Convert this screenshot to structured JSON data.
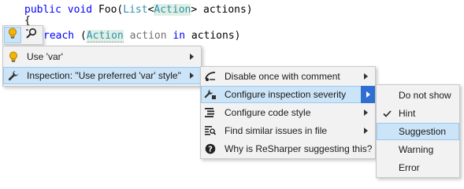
{
  "editor": {
    "line1": {
      "kw_public": "public",
      "kw_void": "void",
      "method": "Foo(",
      "type_list": "List",
      "lt": "<",
      "type_action": "Action",
      "gt": ">",
      "param": "actions)"
    },
    "line2": {
      "brace": "{"
    },
    "line3": {
      "kw_foreach": "reach",
      "open": "(",
      "type_action": "Action",
      "var": "action",
      "kw_in": "in",
      "rest": "actions)"
    }
  },
  "bulb_bar": {
    "bulb_icon": "lightbulb-icon",
    "find_icon": "find-usages-icon"
  },
  "menu1": {
    "items": [
      {
        "label": "Use 'var'",
        "icon": "lightbulb-icon"
      },
      {
        "label": "Inspection: \"Use preferred 'var' style\"",
        "icon": "wrench-icon"
      }
    ]
  },
  "menu2": {
    "items": [
      {
        "label": "Disable once with comment",
        "icon": "disable-comment-icon"
      },
      {
        "label": "Configure inspection severity",
        "icon": "severity-icon"
      },
      {
        "label": "Configure code style",
        "icon": "code-style-icon"
      },
      {
        "label": "Find similar issues in file",
        "icon": "find-similar-icon"
      },
      {
        "label": "Why is ReSharper suggesting this?",
        "icon": "help-icon"
      }
    ]
  },
  "menu3": {
    "items": [
      {
        "label": "Do not show"
      },
      {
        "label": "Hint",
        "checked": true
      },
      {
        "label": "Suggestion"
      },
      {
        "label": "Warning"
      },
      {
        "label": "Error"
      }
    ]
  },
  "colors": {
    "highlight": "#cce4f7",
    "highlight_border": "#99c9ef",
    "submenu_arrow_bg": "#2f6fd1",
    "menu_bg": "#f2f2f2",
    "keyword": "#0000ff",
    "type": "#2b91af"
  }
}
